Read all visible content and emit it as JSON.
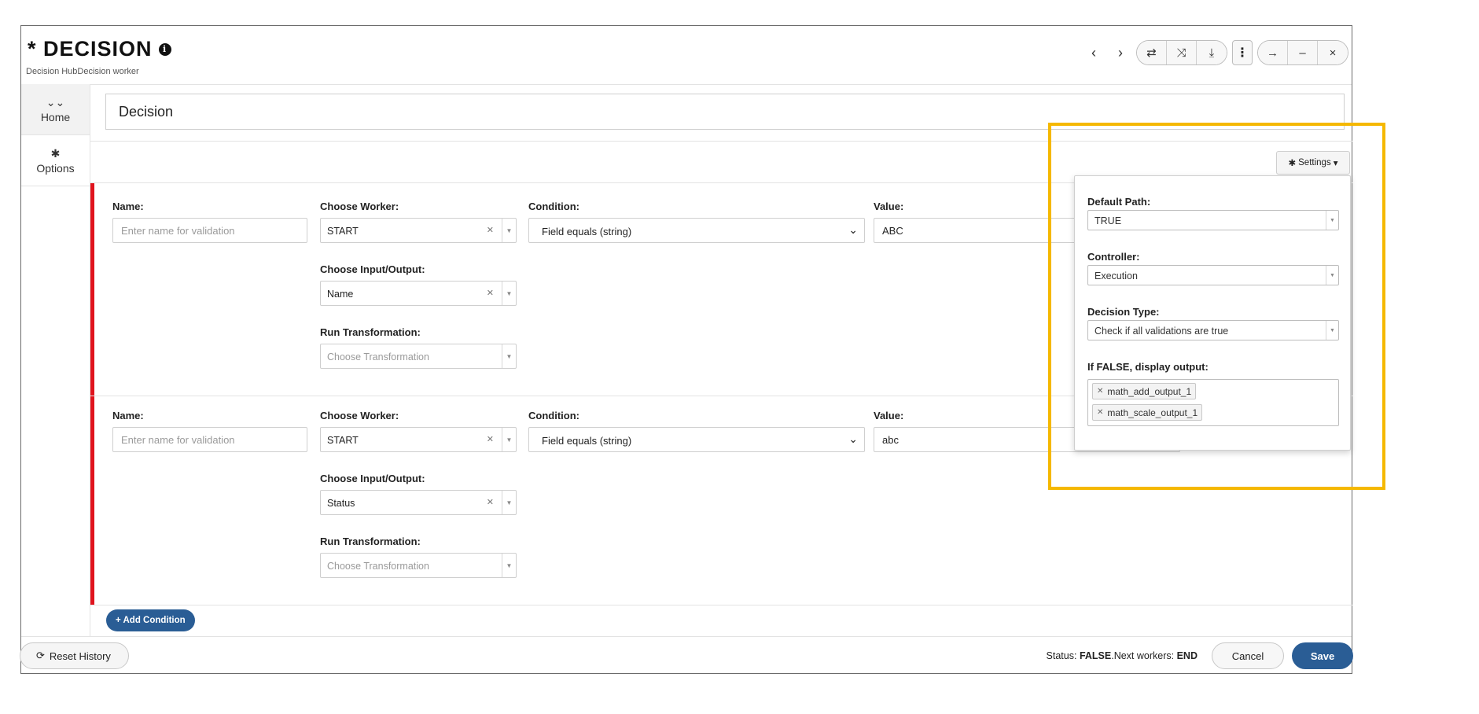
{
  "header": {
    "title": "* DECISION",
    "info_icon": "i",
    "breadcrumb": "Decision HubDecision worker",
    "controls": {
      "prev": "‹",
      "next": "›",
      "pill": [
        "⇄",
        "⤨",
        "⤓"
      ],
      "kebab": "⋮",
      "group2": [
        "→",
        "–",
        "×"
      ]
    }
  },
  "sidebar": {
    "items": [
      {
        "icon": "⌄⌄",
        "label": "Home"
      },
      {
        "icon": "✱",
        "label": "Options"
      }
    ]
  },
  "title_field": {
    "value": "Decision"
  },
  "conditions": [
    {
      "name_label": "Name:",
      "name_placeholder": "Enter name for validation",
      "worker_label": "Choose Worker:",
      "worker_value": "START",
      "condition_label": "Condition:",
      "condition_value": "Field equals (string)",
      "value_label": "Value:",
      "value_value": "ABC",
      "io_label": "Choose Input/Output:",
      "io_value": "Name",
      "transform_label": "Run Transformation:",
      "transform_placeholder": "Choose Transformation"
    },
    {
      "name_label": "Name:",
      "name_placeholder": "Enter name for validation",
      "worker_label": "Choose Worker:",
      "worker_value": "START",
      "condition_label": "Condition:",
      "condition_value": "Field equals (string)",
      "value_label": "Value:",
      "value_value": "abc",
      "io_label": "Choose Input/Output:",
      "io_value": "Status",
      "transform_label": "Run Transformation:",
      "transform_placeholder": "Choose Transformation"
    }
  ],
  "add_condition": "+ Add Condition",
  "settings": {
    "button_label": "Settings",
    "default_path_label": "Default Path:",
    "default_path_value": "TRUE",
    "controller_label": "Controller:",
    "controller_value": "Execution",
    "decision_type_label": "Decision Type:",
    "decision_type_value": "Check if all validations are true",
    "false_output_label": "If FALSE, display output:",
    "false_outputs": [
      "math_add_output_1",
      "math_scale_output_1"
    ]
  },
  "footer": {
    "reset_label": "Reset History",
    "status_prefix": "Status: ",
    "status_value": "FALSE",
    "next_prefix": ".Next workers: ",
    "next_value": "END",
    "cancel_label": "Cancel",
    "save_label": "Save"
  },
  "colors": {
    "accent": "#2a5d95",
    "invalid_bar": "#e0141d",
    "highlight": "#f5b800"
  }
}
